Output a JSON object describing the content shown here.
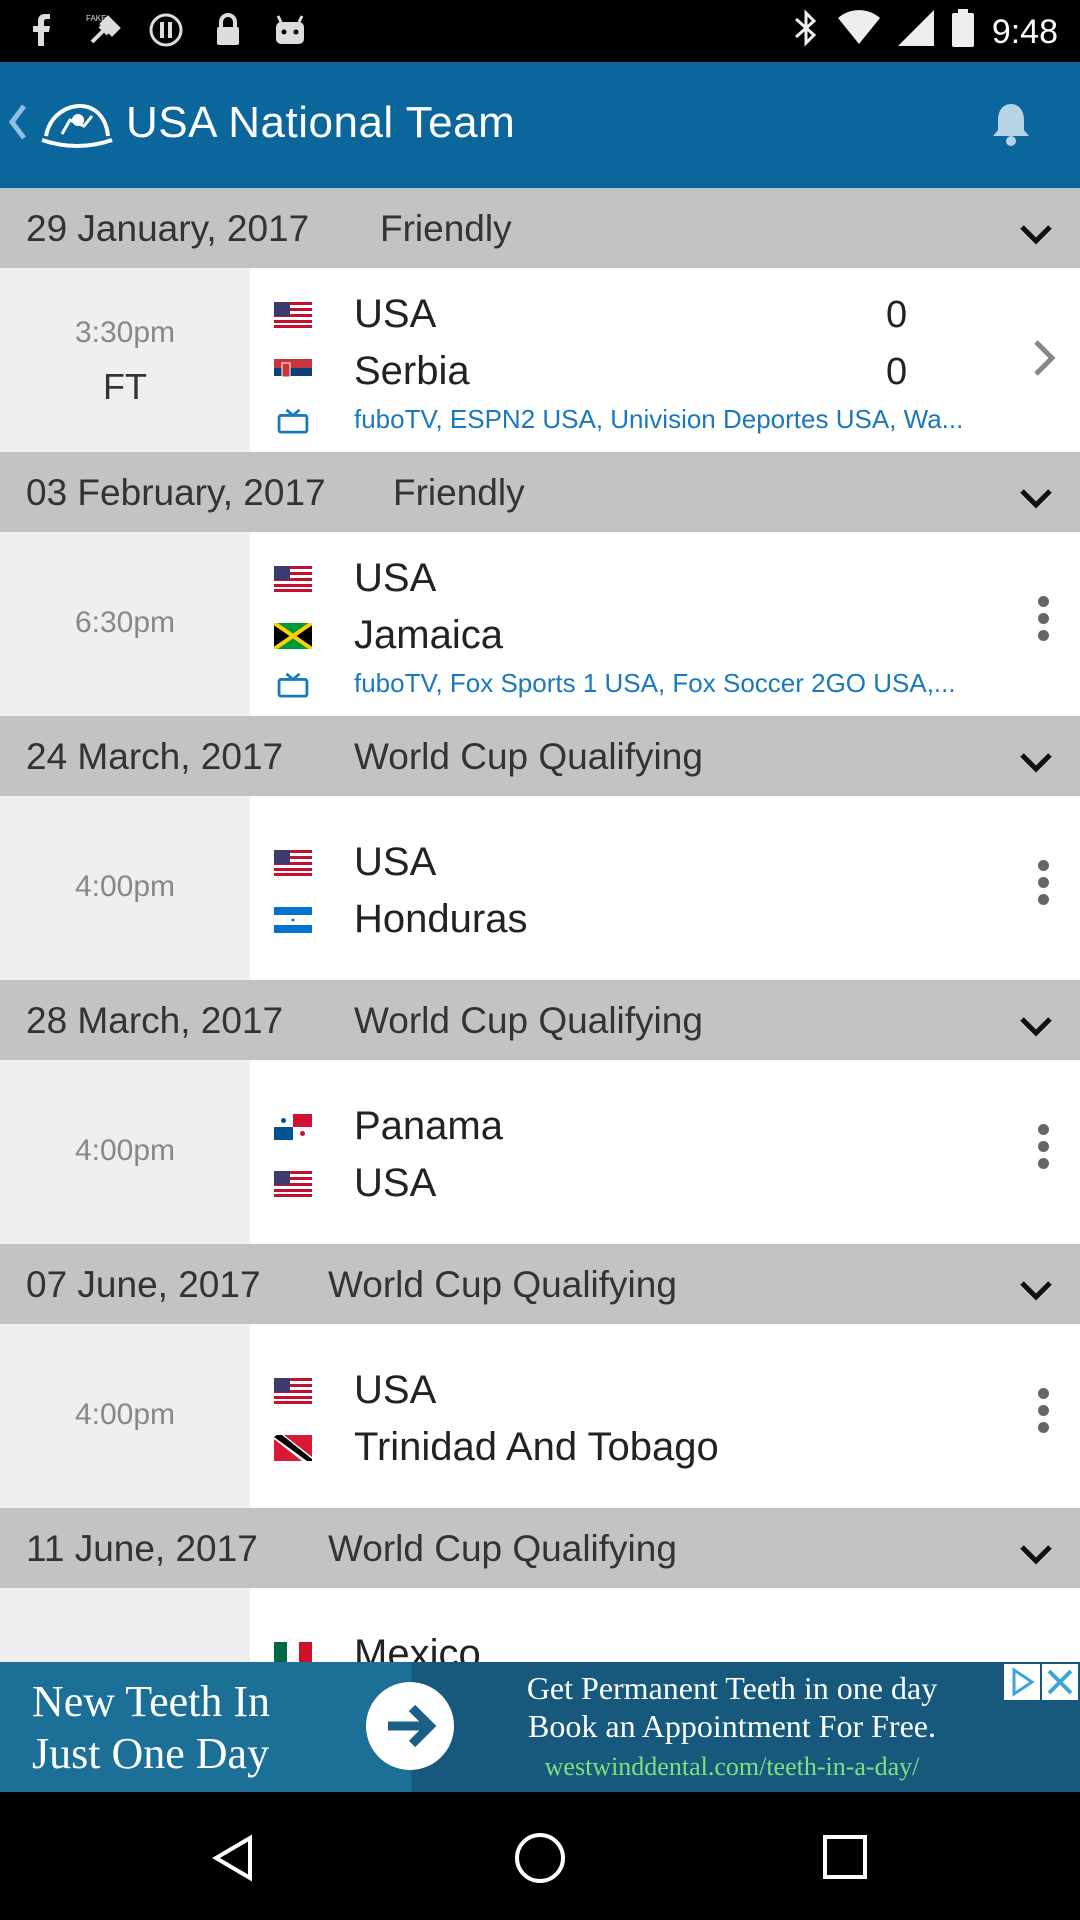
{
  "status_bar": {
    "time": "9:48",
    "icons": [
      "facebook-icon",
      "fake-gps-icon",
      "pause-icon",
      "lock-icon",
      "android-icon",
      "bluetooth-icon",
      "wifi-icon",
      "signal-icon",
      "battery-icon"
    ]
  },
  "app_bar": {
    "title": "USA National Team",
    "background_color": "#0b669b"
  },
  "matches": [
    {
      "date": "29 January, 2017",
      "competition": "Friendly",
      "time": "3:30pm",
      "status": "FT",
      "teams": [
        {
          "name": "USA",
          "flag": "usa-flag-icon",
          "score": "0"
        },
        {
          "name": "Serbia",
          "flag": "serbia-flag-icon",
          "score": "0"
        }
      ],
      "tv": "fuboTV, ESPN2 USA, Univision Deportes USA, Wa..."
    },
    {
      "date": "03 February, 2017",
      "competition": "Friendly",
      "time": "6:30pm",
      "teams": [
        {
          "name": "USA",
          "flag": "usa-flag-icon"
        },
        {
          "name": "Jamaica",
          "flag": "jamaica-flag-icon"
        }
      ],
      "tv": "fuboTV, Fox Sports 1 USA, Fox Soccer 2GO USA,..."
    },
    {
      "date": "24 March, 2017",
      "competition": "World Cup Qualifying",
      "time": "4:00pm",
      "teams": [
        {
          "name": "USA",
          "flag": "usa-flag-icon"
        },
        {
          "name": "Honduras",
          "flag": "honduras-flag-icon"
        }
      ]
    },
    {
      "date": "28 March, 2017",
      "competition": "World Cup Qualifying",
      "time": "4:00pm",
      "teams": [
        {
          "name": "Panama",
          "flag": "panama-flag-icon"
        },
        {
          "name": "USA",
          "flag": "usa-flag-icon"
        }
      ]
    },
    {
      "date": "07 June, 2017",
      "competition": "World Cup Qualifying",
      "time": "4:00pm",
      "teams": [
        {
          "name": "USA",
          "flag": "usa-flag-icon"
        },
        {
          "name": "Trinidad And Tobago",
          "flag": "trinidad-flag-icon"
        }
      ]
    },
    {
      "date": "11 June, 2017",
      "competition": "World Cup Qualifying",
      "teams": [
        {
          "name": "Mexico",
          "flag": "mexico-flag-icon"
        }
      ]
    }
  ],
  "ad": {
    "left_text_line1": "New Teeth In",
    "left_text_line2": "Just One Day",
    "right_line1": "Get Permanent Teeth in one day",
    "right_line2": "Book an Appointment For Free.",
    "url": "westwinddental.com/teeth-in-a-day/"
  }
}
